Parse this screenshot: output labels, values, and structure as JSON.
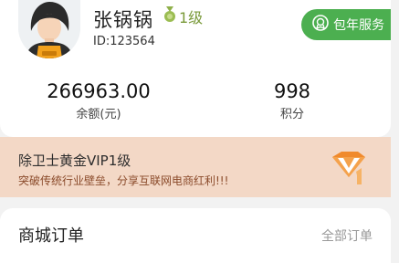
{
  "profile": {
    "username": "张锅锅",
    "level_label": "1级",
    "user_id": "ID:123564",
    "vip_button_label": "包年服务"
  },
  "stats": {
    "balance_value": "266963.00",
    "balance_label": "余额(元)",
    "points_value": "998",
    "points_label": "积分"
  },
  "banner": {
    "title": "除卫士黄金VIP1级",
    "subtitle": "突破传统行业壁垒，分享互联网电商红利!!!"
  },
  "orders": {
    "title": "商城订单",
    "all_label": "全部订单"
  },
  "colors": {
    "accent_green": "#4caf50",
    "banner_bg": "#f3d8c6",
    "vip_orange": "#f08a2c"
  },
  "icons": [
    "avatar",
    "medal-icon",
    "vip-badge-icon",
    "vip-diamond-icon"
  ]
}
